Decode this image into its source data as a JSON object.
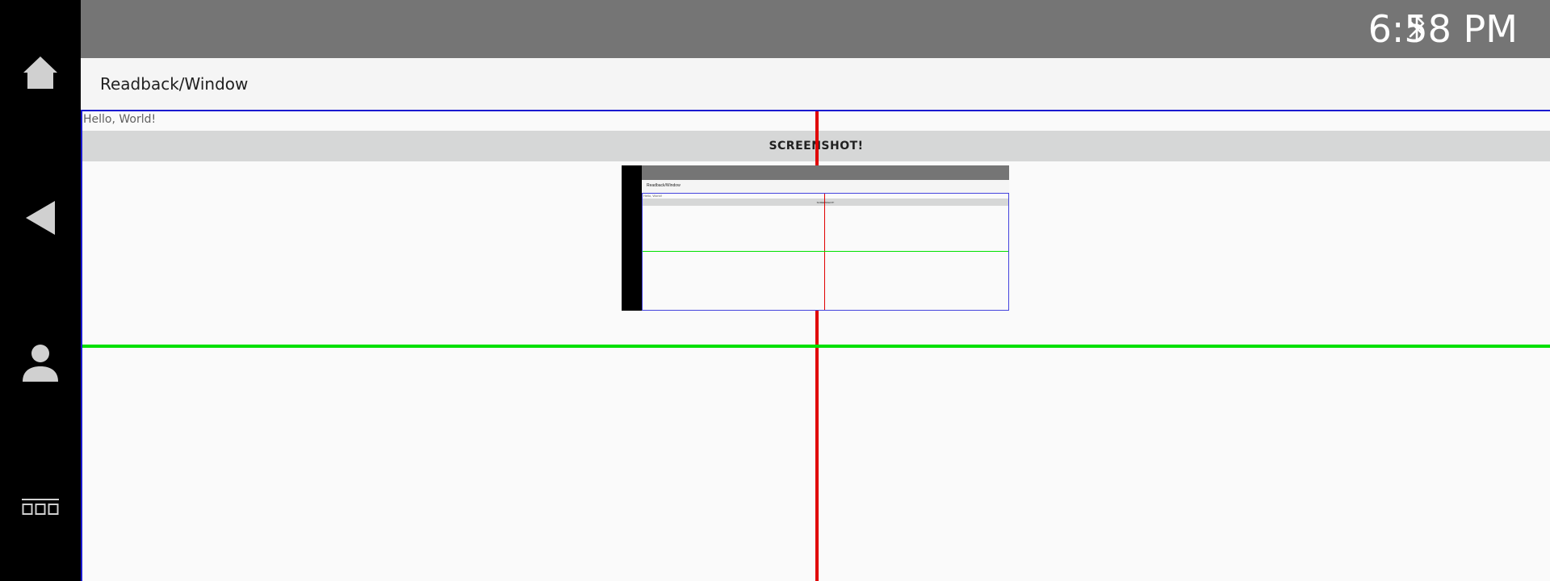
{
  "status_bar": {
    "time": "6:58 PM",
    "bluetooth_icon": "bluetooth-icon"
  },
  "nav_rail": {
    "items": [
      {
        "icon": "home-icon"
      },
      {
        "icon": "back-icon"
      },
      {
        "icon": "user-icon"
      },
      {
        "icon": "apps-grid-icon"
      }
    ]
  },
  "app_bar": {
    "title": "Readback/Window"
  },
  "content": {
    "hello_text": "Hello, World!",
    "screenshot_button_label": "SCREENSHOT!",
    "colors": {
      "border": "#1a1ad0",
      "vertical_line": "#e00000",
      "horizontal_line": "#00e000"
    }
  },
  "thumbnail": {
    "title": "Readback/Window",
    "hello_text": "Hello, World!",
    "button_label": "SCREENSHOT!"
  }
}
